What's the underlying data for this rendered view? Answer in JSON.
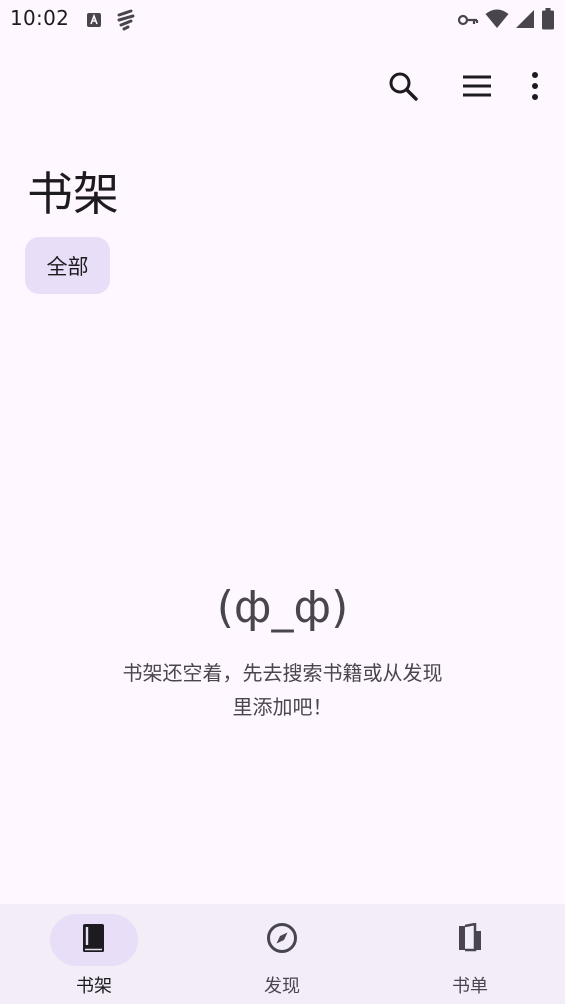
{
  "status_bar": {
    "time": "10:02",
    "left_icons": [
      "font-app-icon",
      "signal-app-icon"
    ],
    "right_icons": [
      "vpn-key-icon",
      "wifi-icon",
      "cell-signal-icon",
      "battery-icon"
    ]
  },
  "toolbar": {
    "actions": [
      "search-icon",
      "menu-icon",
      "more-vert-icon"
    ]
  },
  "page": {
    "title": "书架"
  },
  "filter_chip": {
    "label": "全部"
  },
  "empty_state": {
    "face": "(ф_ф)",
    "message": "书架还空着，先去搜索书籍或从发现里添加吧！"
  },
  "bottom_nav": {
    "items": [
      {
        "label": "书架",
        "icon": "book-icon",
        "active": true
      },
      {
        "label": "发现",
        "icon": "compass-icon",
        "active": false
      },
      {
        "label": "书单",
        "icon": "book-list-icon",
        "active": false
      }
    ]
  },
  "colors": {
    "background": "#fef7ff",
    "chip": "#e8def8",
    "nav_bar": "#f3edf7",
    "text": "#1d1b20",
    "secondary_text": "#49454f"
  }
}
